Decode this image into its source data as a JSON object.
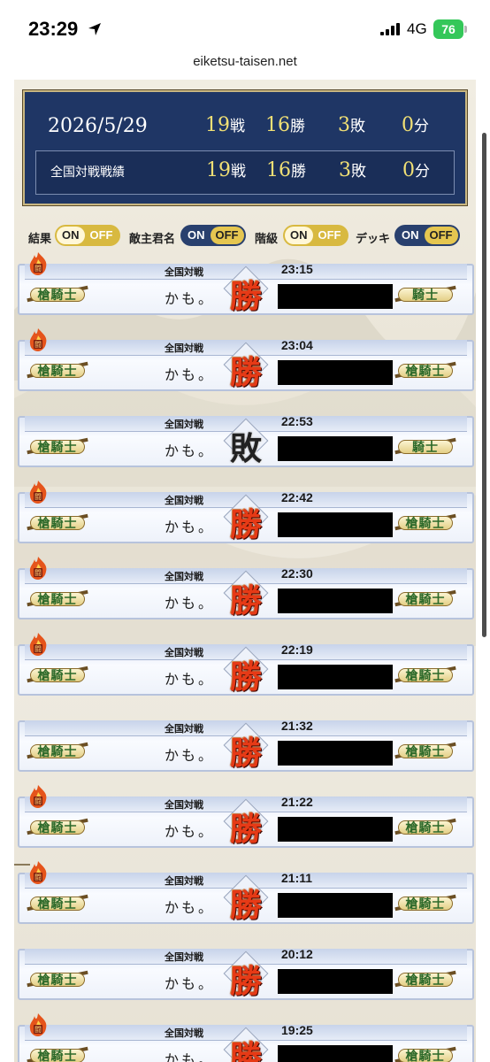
{
  "status_bar": {
    "time": "23:29",
    "network": "4G",
    "battery": "76"
  },
  "url": "eiketsu-taisen.net",
  "summary": {
    "date": "2026/5/29",
    "label": "全国対戦戦績",
    "row1": {
      "battles": "19",
      "battles_unit": "戦",
      "wins": "16",
      "wins_unit": "勝",
      "losses": "3",
      "losses_unit": "敗",
      "draws": "0",
      "draws_unit": "分"
    },
    "row2": {
      "battles": "19",
      "battles_unit": "戦",
      "wins": "16",
      "wins_unit": "勝",
      "losses": "3",
      "losses_unit": "敗",
      "draws": "0",
      "draws_unit": "分"
    }
  },
  "toggles": [
    {
      "label": "結果",
      "on": "ON",
      "off": "OFF",
      "state": "on"
    },
    {
      "label": "敵主君名",
      "on": "ON",
      "off": "OFF",
      "state": "on"
    },
    {
      "label": "階級",
      "on": "ON",
      "off": "OFF",
      "state": "on"
    },
    {
      "label": "デッキ",
      "on": "ON",
      "off": "OFF",
      "state": "off"
    }
  ],
  "battles": [
    {
      "mode": "全国対戦",
      "time": "23:15",
      "player": "かも。",
      "result": "勝",
      "rank_left": "槍騎士",
      "rank_right": "騎士",
      "flame": true
    },
    {
      "mode": "全国対戦",
      "time": "23:04",
      "player": "かも。",
      "result": "勝",
      "rank_left": "槍騎士",
      "rank_right": "槍騎士",
      "flame": true
    },
    {
      "mode": "全国対戦",
      "time": "22:53",
      "player": "かも。",
      "result": "敗",
      "rank_left": "槍騎士",
      "rank_right": "騎士",
      "flame": false
    },
    {
      "mode": "全国対戦",
      "time": "22:42",
      "player": "かも。",
      "result": "勝",
      "rank_left": "槍騎士",
      "rank_right": "槍騎士",
      "flame": true
    },
    {
      "mode": "全国対戦",
      "time": "22:30",
      "player": "かも。",
      "result": "勝",
      "rank_left": "槍騎士",
      "rank_right": "槍騎士",
      "flame": true
    },
    {
      "mode": "全国対戦",
      "time": "22:19",
      "player": "かも。",
      "result": "勝",
      "rank_left": "槍騎士",
      "rank_right": "槍騎士",
      "flame": true
    },
    {
      "mode": "全国対戦",
      "time": "21:32",
      "player": "かも。",
      "result": "勝",
      "rank_left": "槍騎士",
      "rank_right": "槍騎士",
      "flame": false
    },
    {
      "mode": "全国対戦",
      "time": "21:22",
      "player": "かも。",
      "result": "勝",
      "rank_left": "槍騎士",
      "rank_right": "槍騎士",
      "flame": true
    },
    {
      "mode": "全国対戦",
      "time": "21:11",
      "player": "かも。",
      "result": "勝",
      "rank_left": "槍騎士",
      "rank_right": "槍騎士",
      "flame": true
    },
    {
      "mode": "全国対戦",
      "time": "20:12",
      "player": "かも。",
      "result": "勝",
      "rank_left": "槍騎士",
      "rank_right": "槍騎士",
      "flame": false
    },
    {
      "mode": "全国対戦",
      "time": "19:25",
      "player": "かも。",
      "result": "勝",
      "rank_left": "槍騎士",
      "rank_right": "槍騎士",
      "flame": true
    }
  ],
  "colors": {
    "summary_bg": "#1f3665",
    "stat_number": "#f1e075",
    "win_mark": "#e63a16",
    "toggle_gold": "#d8b940",
    "toggle_navy": "#29406e"
  }
}
